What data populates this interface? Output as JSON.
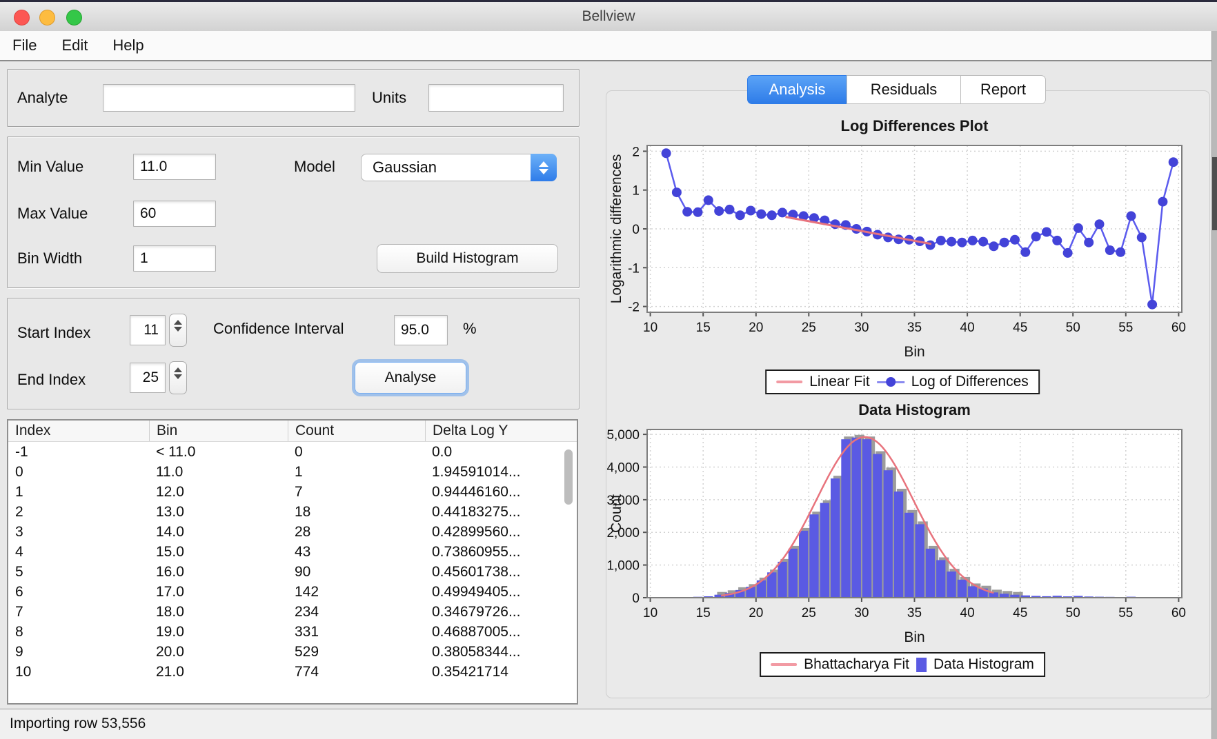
{
  "window": {
    "title": "Bellview",
    "menu": [
      "File",
      "Edit",
      "Help"
    ],
    "status": "Importing row 53,556",
    "traffic_lights": {
      "close": "#fc5753",
      "minimize": "#fdbc40",
      "zoom": "#34c748"
    }
  },
  "form": {
    "analyte_label": "Analyte",
    "analyte_value": "",
    "units_label": "Units",
    "units_value": "",
    "min_label": "Min Value",
    "min_value": "11.0",
    "max_label": "Max Value",
    "max_value": "60",
    "bin_width_label": "Bin Width",
    "bin_width_value": "1",
    "model_label": "Model",
    "model_value": "Gaussian",
    "build_button": "Build Histogram",
    "start_index_label": "Start Index",
    "start_index_value": "11",
    "end_index_label": "End Index",
    "end_index_value": "25",
    "ci_label": "Confidence Interval",
    "ci_value": "95.0",
    "ci_unit": "%",
    "analyse_button": "Analyse"
  },
  "table": {
    "columns": [
      "Index",
      "Bin",
      "Count",
      "Delta Log Y"
    ],
    "rows": [
      [
        "-1",
        "< 11.0",
        "0",
        "0.0"
      ],
      [
        "0",
        "11.0",
        "1",
        "1.94591014..."
      ],
      [
        "1",
        "12.0",
        "7",
        "0.94446160..."
      ],
      [
        "2",
        "13.0",
        "18",
        "0.44183275..."
      ],
      [
        "3",
        "14.0",
        "28",
        "0.42899560..."
      ],
      [
        "4",
        "15.0",
        "43",
        "0.73860955..."
      ],
      [
        "5",
        "16.0",
        "90",
        "0.45601738..."
      ],
      [
        "6",
        "17.0",
        "142",
        "0.49949405..."
      ],
      [
        "7",
        "18.0",
        "234",
        "0.34679726..."
      ],
      [
        "8",
        "19.0",
        "331",
        "0.46887005..."
      ],
      [
        "9",
        "20.0",
        "529",
        "0.38058344..."
      ],
      [
        "10",
        "21.0",
        "774",
        "0.35421714"
      ]
    ]
  },
  "tabs": [
    {
      "label": "Analysis",
      "selected": true
    },
    {
      "label": "Residuals",
      "selected": false
    },
    {
      "label": "Report",
      "selected": false
    }
  ],
  "chart_data": [
    {
      "type": "line",
      "title": "Log Differences Plot",
      "xlabel": "Bin",
      "ylabel": "Logarithmic differences",
      "xlim": [
        9.7,
        60.3
      ],
      "ylim": [
        -2.15,
        2.15
      ],
      "xticks": [
        10,
        15,
        20,
        25,
        30,
        35,
        40,
        45,
        50,
        55,
        60
      ],
      "yticks": [
        -2,
        -1,
        0,
        1,
        2
      ],
      "grid": true,
      "legend_position": "below",
      "series": [
        {
          "name": "Linear Fit",
          "type": "line",
          "color": "#e8737d",
          "x": [
            22.8,
            36.6
          ],
          "y": [
            0.31,
            -0.39
          ]
        },
        {
          "name": "Log of Differences",
          "type": "line+markers",
          "color": "#4343d8",
          "line_color": "#5b5bee",
          "x": [
            11.5,
            12.5,
            13.5,
            14.5,
            15.5,
            16.5,
            17.5,
            18.5,
            19.5,
            20.5,
            21.5,
            22.5,
            23.5,
            24.5,
            25.5,
            26.5,
            27.5,
            28.5,
            29.5,
            30.5,
            31.5,
            32.5,
            33.5,
            34.5,
            35.5,
            36.5,
            37.5,
            38.5,
            39.5,
            40.5,
            41.5,
            42.5,
            43.5,
            44.5,
            45.5,
            46.5,
            47.5,
            48.5,
            49.5,
            50.5,
            51.5,
            52.5,
            53.5,
            54.5,
            55.5,
            56.5,
            57.5,
            58.5,
            59.5
          ],
          "y": [
            1.95,
            0.94,
            0.44,
            0.43,
            0.74,
            0.46,
            0.5,
            0.35,
            0.47,
            0.38,
            0.35,
            0.42,
            0.37,
            0.33,
            0.28,
            0.22,
            0.12,
            0.1,
            0.0,
            -0.07,
            -0.15,
            -0.22,
            -0.27,
            -0.28,
            -0.32,
            -0.42,
            -0.3,
            -0.33,
            -0.35,
            -0.3,
            -0.33,
            -0.45,
            -0.35,
            -0.28,
            -0.6,
            -0.2,
            -0.08,
            -0.3,
            -0.62,
            0.02,
            -0.35,
            0.12,
            -0.55,
            -0.6,
            0.33,
            -0.22,
            -1.95,
            0.7,
            1.72
          ]
        }
      ]
    },
    {
      "type": "bar",
      "title": "Data Histogram",
      "xlabel": "Bin",
      "ylabel": "Count",
      "xlim": [
        9.7,
        60.3
      ],
      "ylim": [
        0,
        5150
      ],
      "xticks": [
        10,
        15,
        20,
        25,
        30,
        35,
        40,
        45,
        50,
        55,
        60
      ],
      "yticks": [
        0,
        1000,
        2000,
        3000,
        4000,
        5000
      ],
      "ytick_format": "comma",
      "grid": true,
      "legend_position": "below",
      "bars": {
        "name": "Data Histogram",
        "color": "#5a5ae3",
        "shadow_color": "#9c9c9c",
        "bin_start": 11,
        "bin_width": 1,
        "values": [
          1,
          7,
          18,
          28,
          43,
          90,
          142,
          234,
          331,
          529,
          774,
          1100,
          1500,
          2050,
          2550,
          2900,
          3650,
          4850,
          4900,
          4850,
          4400,
          3900,
          3250,
          2600,
          2250,
          1500,
          1150,
          800,
          550,
          350,
          280,
          160,
          120,
          90,
          70,
          55,
          45,
          60,
          40,
          55,
          35,
          30,
          25,
          20,
          30,
          15,
          20,
          10
        ]
      },
      "fit": {
        "name": "Bhattacharya Fit",
        "color": "#e8737d",
        "amp": 4920,
        "mean": 30.3,
        "sigma": 4.6,
        "from": 16.7,
        "to": 42.6
      }
    }
  ]
}
